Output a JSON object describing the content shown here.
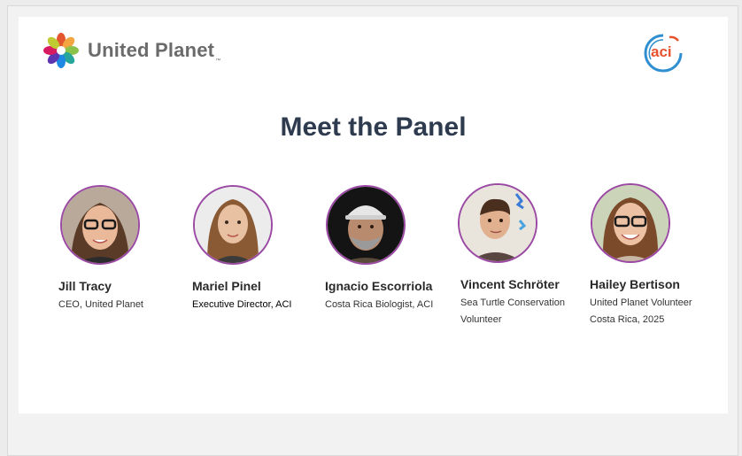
{
  "header": {
    "brand_name": "United Planet",
    "brand_tm": "™",
    "partner_logo_text": "aci"
  },
  "slide": {
    "title": "Meet the Panel"
  },
  "panel": [
    {
      "name": "Jill Tracy",
      "role_line1": "CEO, United Planet",
      "role_line2": ""
    },
    {
      "name": "Mariel Pinel",
      "role_line1": "Executive Director, ACI",
      "role_line2": ""
    },
    {
      "name": "Ignacio Escorriola",
      "role_line1": "Costa Rica Biologist, ACI",
      "role_line2": ""
    },
    {
      "name": "Vincent Schröter",
      "role_line1": "Sea Turtle Conservation",
      "role_line2": "Volunteer"
    },
    {
      "name": "Hailey Bertison",
      "role_line1": "United Planet Volunteer",
      "role_line2": "Costa Rica, 2025"
    }
  ],
  "colors": {
    "title": "#2e3b4e",
    "avatar_ring": "#9b4aa4",
    "aci_orange": "#e8532f",
    "aci_blue": "#2f8fd0"
  }
}
